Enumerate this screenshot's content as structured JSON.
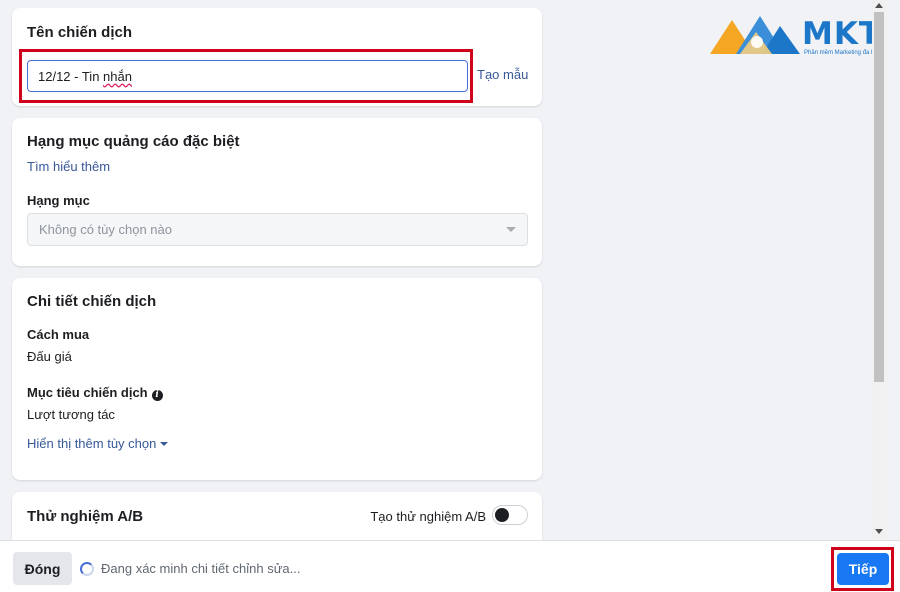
{
  "campaign_name": {
    "title": "Tên chiến dịch",
    "value_prefix": "12/12 - Tin ",
    "value_flagged_word": "nhắn",
    "template_link": "Tạo mẫu"
  },
  "special_ad": {
    "title": "Hạng mục quảng cáo đặc biệt",
    "learn_more": "Tìm hiểu thêm",
    "category_label": "Hạng mục",
    "category_placeholder": "Không có tùy chọn nào"
  },
  "campaign_details": {
    "title": "Chi tiết chiến dịch",
    "buying_type_label": "Cách mua",
    "buying_type_value": "Đấu giá",
    "objective_label": "Mục tiêu chiến dịch",
    "objective_value": "Lượt tương tác",
    "more_options": "Hiển thị thêm tùy chọn"
  },
  "ab_test": {
    "title": "Thử nghiệm A/B",
    "toggle_label": "Tạo thử nghiệm A/B",
    "toggle_on": false
  },
  "footer": {
    "close_label": "Đóng",
    "status_text": "Đang xác minh chi tiết chỉnh sửa...",
    "next_label": "Tiếp"
  },
  "logo": {
    "word": "MKT",
    "tagline": "Phần mềm Marketing đa kênh"
  },
  "icons": {
    "info": "info-icon",
    "caret": "caret-down-icon",
    "spinner": "loading-spinner-icon"
  },
  "colors": {
    "link": "#385898",
    "primary": "#1877f2",
    "highlight": "#d0021b",
    "logo_blue": "#1d77c9",
    "logo_orange": "#f5a623"
  }
}
